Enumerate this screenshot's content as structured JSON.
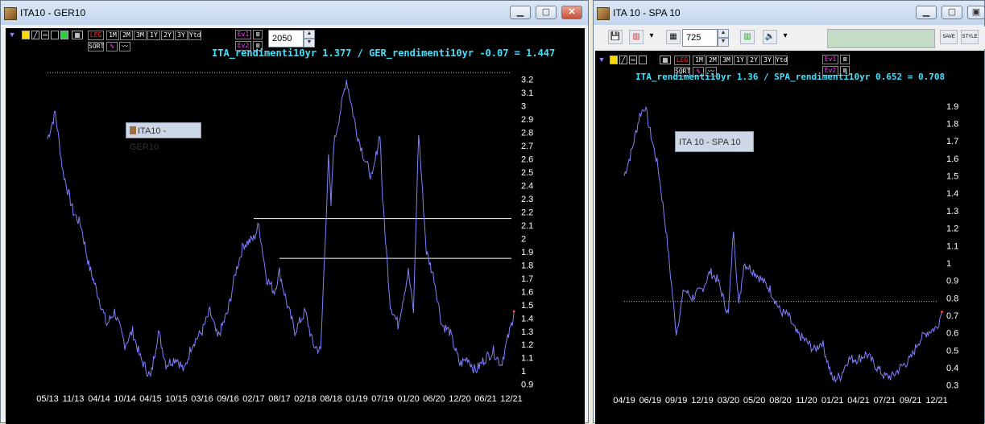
{
  "left_window": {
    "title": "ITA10 - GER10",
    "lookback_value": "2050",
    "legend_label": "ITA10 - GER10",
    "formula": "ITA_rendimenti10yr 1.377 / GER_rendimenti10yr -0.07 = 1.447",
    "toolbar": [
      "LEG",
      "1M",
      "2M",
      "3M",
      "1Y",
      "2Y",
      "3Y",
      "Ytd"
    ],
    "toolbar2": [
      "SORT"
    ],
    "ev_buttons": [
      "Ev1",
      "Ev2"
    ]
  },
  "right_window": {
    "title": "ITA 10 - SPA 10",
    "lookback_value": "725",
    "legend_label": "ITA 10 - SPA 10",
    "formula": "ITA_rendimenti10yr 1.36 / SPA_rendimenti10yr 0.652 = 0.708",
    "toolbar": [
      "LEG",
      "1M",
      "2M",
      "3M",
      "1Y",
      "2Y",
      "3Y",
      "Ytd"
    ],
    "toolbar2": [
      "SORT"
    ],
    "ev_buttons": [
      "Ev1",
      "Ev2"
    ],
    "save_label": "SAVE",
    "style_label": "STYLE"
  },
  "colors": {
    "series": "#8080ff",
    "background": "#000000",
    "formula": "#40e0ff",
    "hline": "#ffffff"
  },
  "chart_data": [
    {
      "type": "line",
      "title": "ITA10 - GER10",
      "x_tick_labels": [
        "05/13",
        "11/13",
        "04/14",
        "10/14",
        "04/15",
        "10/15",
        "03/16",
        "09/16",
        "02/17",
        "08/17",
        "02/18",
        "08/18",
        "01/19",
        "07/19",
        "01/20",
        "06/20",
        "12/20",
        "06/21",
        "12/21"
      ],
      "y_ticks": [
        0.9,
        1,
        1.1,
        1.2,
        1.3,
        1.4,
        1.5,
        1.6,
        1.7,
        1.8,
        1.9,
        2,
        2.1,
        2.2,
        2.3,
        2.4,
        2.5,
        2.6,
        2.7,
        2.8,
        2.9,
        3,
        3.1,
        3.2
      ],
      "ylim": [
        0.88,
        3.27
      ],
      "horizontal_lines": [
        {
          "y": 3.25,
          "style": "dotted",
          "from": "05/13",
          "to": "12/21"
        },
        {
          "y": 2.15,
          "style": "solid",
          "from": "02/17",
          "to": "12/21"
        },
        {
          "y": 1.85,
          "style": "solid",
          "from": "08/17",
          "to": "12/21"
        }
      ],
      "series": [
        {
          "x_index": [
            0,
            0.3,
            0.6,
            1,
            1.3,
            1.6,
            2,
            2.3,
            2.6,
            3,
            3.3,
            3.6,
            4,
            4.3,
            4.6,
            5,
            5.3,
            5.6,
            6,
            6.3,
            6.6,
            7,
            7.3,
            7.6,
            8,
            8.2,
            8.5,
            8.8,
            9,
            9.3,
            9.6,
            10,
            10.3,
            10.6,
            10.9,
            11,
            11.1,
            11.3,
            11.6,
            12,
            12.3,
            12.6,
            12.9,
            13,
            13.3,
            13.6,
            14,
            14.2,
            14.4,
            14.7,
            15,
            15.3,
            15.6,
            16,
            16.3,
            16.6,
            17,
            17.3,
            17.6,
            18,
            18.1
          ],
          "values": [
            2.75,
            2.95,
            2.5,
            2.2,
            2.1,
            1.8,
            1.55,
            1.35,
            1.45,
            1.2,
            1.3,
            1.1,
            0.95,
            1.3,
            1.05,
            1.1,
            1.0,
            1.2,
            1.3,
            1.45,
            1.25,
            1.45,
            1.75,
            1.95,
            2.0,
            2.1,
            1.7,
            1.6,
            1.75,
            1.5,
            1.3,
            1.45,
            1.2,
            1.15,
            2.6,
            2.25,
            2.7,
            2.9,
            3.2,
            2.8,
            2.6,
            2.45,
            2.8,
            2.3,
            1.5,
            1.35,
            1.75,
            1.45,
            2.8,
            1.9,
            1.7,
            1.35,
            1.3,
            1.05,
            1.1,
            1.0,
            1.1,
            1.15,
            1.05,
            1.35,
            1.45
          ]
        }
      ]
    },
    {
      "type": "line",
      "title": "ITA 10 - SPA 10",
      "x_tick_labels": [
        "04/19",
        "06/19",
        "09/19",
        "12/19",
        "03/20",
        "05/20",
        "08/20",
        "11/20",
        "01/21",
        "04/21",
        "07/21",
        "09/21",
        "12/21"
      ],
      "y_ticks": [
        0.3,
        0.4,
        0.5,
        0.6,
        0.7,
        0.8,
        0.9,
        1,
        1.1,
        1.2,
        1.3,
        1.4,
        1.5,
        1.6,
        1.7,
        1.8,
        1.9
      ],
      "ylim": [
        0.28,
        1.95
      ],
      "horizontal_lines": [
        {
          "y": 0.78,
          "style": "dotted",
          "from": "04/19",
          "to": "12/21"
        }
      ],
      "series": [
        {
          "x_index": [
            0,
            0.3,
            0.6,
            0.8,
            1,
            1.3,
            1.6,
            2,
            2.3,
            2.6,
            3,
            3.3,
            3.6,
            4,
            4.2,
            4.4,
            4.6,
            5,
            5.3,
            5.6,
            6,
            6.3,
            6.6,
            7,
            7.3,
            7.6,
            8,
            8.3,
            8.6,
            9,
            9.3,
            9.6,
            10,
            10.3,
            10.6,
            11,
            11.3,
            11.6,
            12,
            12.2
          ],
          "values": [
            1.5,
            1.65,
            1.85,
            1.9,
            1.75,
            1.55,
            1.2,
            0.6,
            0.85,
            0.8,
            0.85,
            0.95,
            0.9,
            0.7,
            1.2,
            0.75,
            1.0,
            0.95,
            0.9,
            0.85,
            0.72,
            0.7,
            0.6,
            0.55,
            0.5,
            0.55,
            0.33,
            0.35,
            0.45,
            0.45,
            0.48,
            0.42,
            0.35,
            0.35,
            0.4,
            0.45,
            0.55,
            0.6,
            0.63,
            0.72
          ]
        }
      ]
    }
  ]
}
